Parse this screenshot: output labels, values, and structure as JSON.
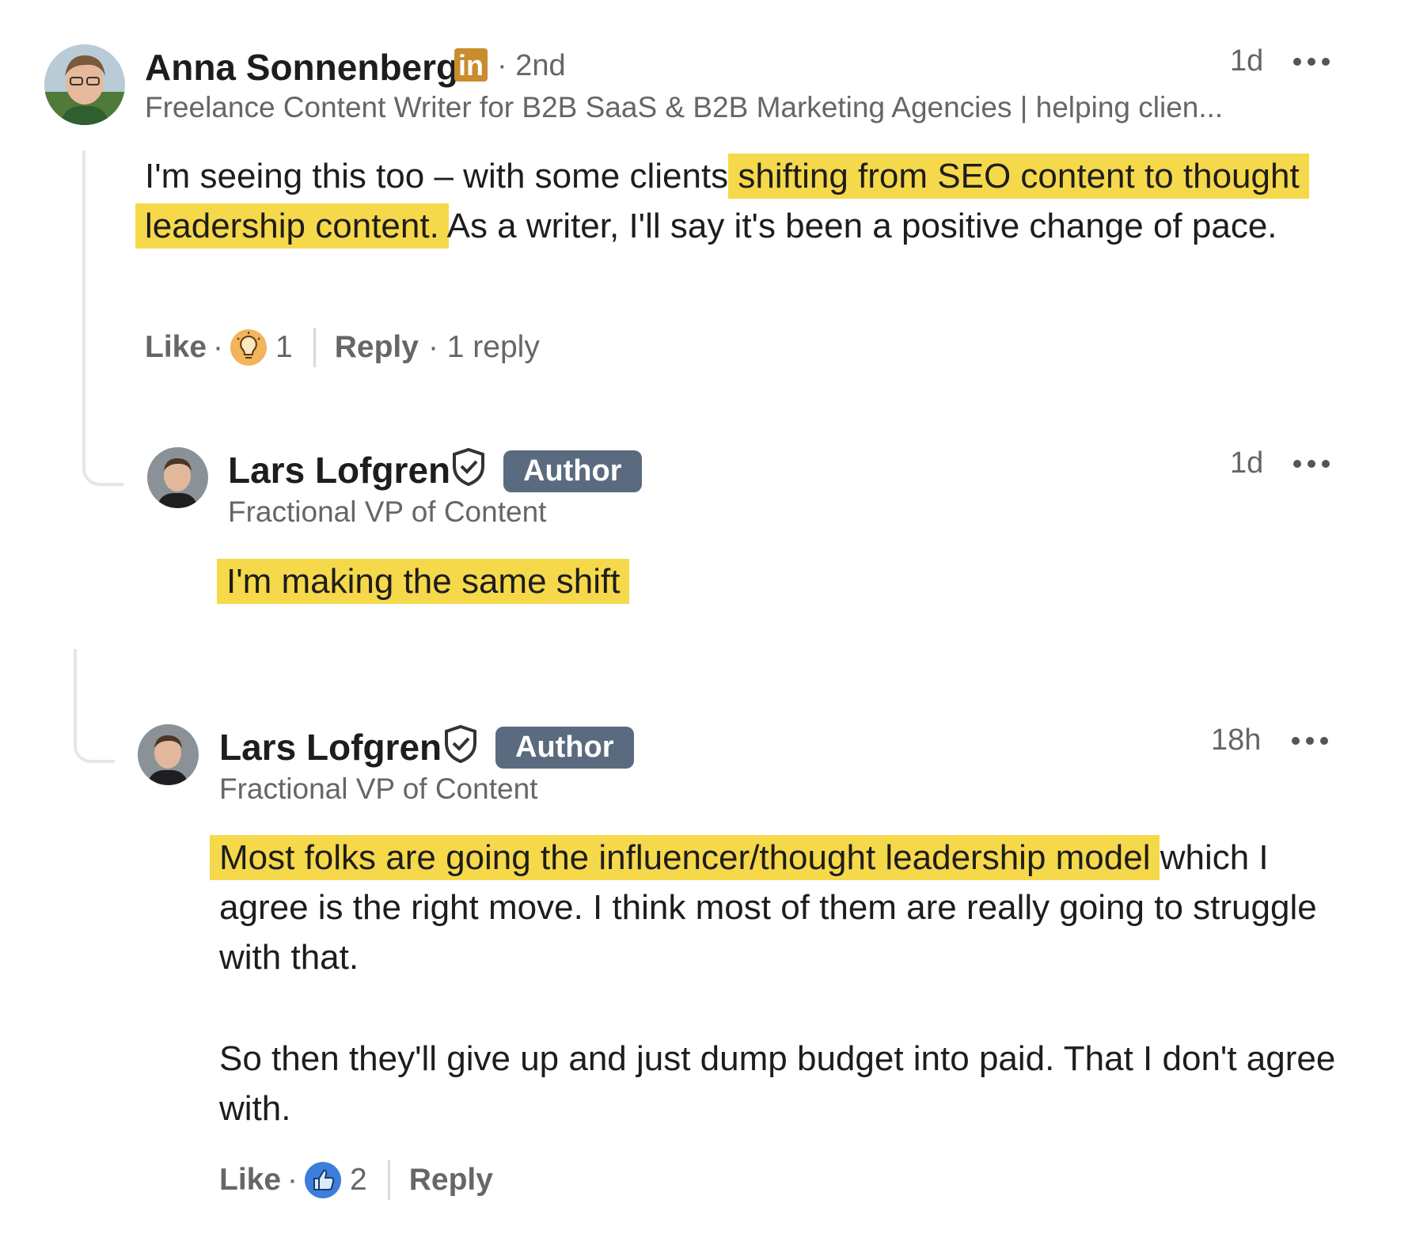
{
  "comments": [
    {
      "author": "Anna Sonnenberg",
      "degree": "· 2nd",
      "headline": "Freelance Content Writer for B2B SaaS & B2B Marketing Agencies | helping clien...",
      "time": "1d",
      "text_before": "I'm seeing this too – with some clients ",
      "text_highlight": "shifting from SEO content to thought leadership content.",
      "text_after": " As a writer, I'll say it's been a positive change of pace.",
      "actions": {
        "like": "Like",
        "reaction_count": "1",
        "reply": "Reply",
        "replies": "· 1 reply",
        "reaction_icon": "lightbulb-icon"
      }
    },
    {
      "author": "Lars Lofgren",
      "badge": "Author",
      "headline": "Fractional VP of Content",
      "time": "1d",
      "text_highlight": "I'm making the same shift"
    },
    {
      "author": "Lars Lofgren",
      "badge": "Author",
      "headline": "Fractional VP of Content",
      "time": "18h",
      "text_highlight": "Most folks are going the influencer/thought leadership model",
      "text_after": " which I agree is the right move. I think most of them are really going to struggle with that.",
      "text_para2": "So then they'll give up and just dump budget into paid. That I don't agree with.",
      "actions": {
        "like": "Like",
        "reaction_count": "2",
        "reply": "Reply",
        "reaction_icon": "thumbs-up-icon"
      }
    }
  ],
  "colors": {
    "highlight": "#f6d84b",
    "author_badge": "#5a6b80",
    "linkedin_badge": "#c98d2e"
  }
}
